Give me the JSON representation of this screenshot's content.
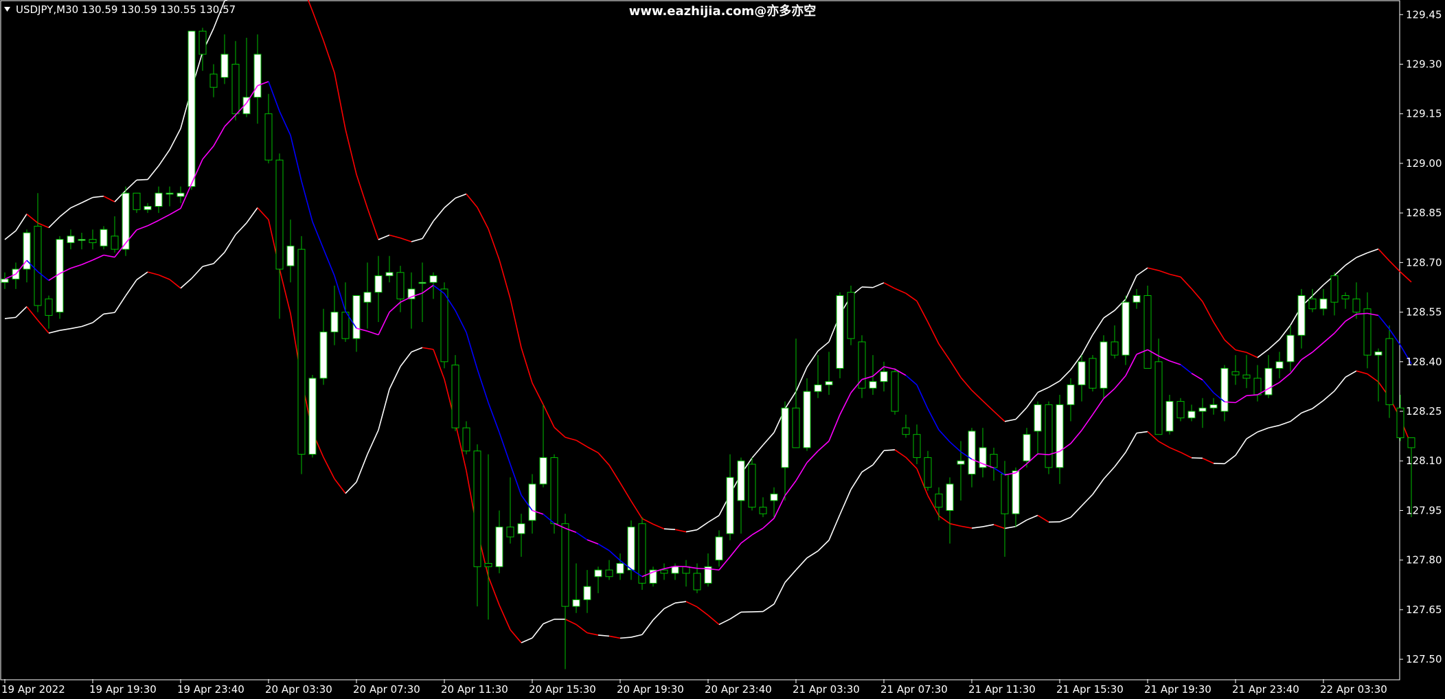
{
  "header": {
    "symbol_info": "USDJPY,M30  130.59 130.59 130.55 130.57",
    "watermark": "www.eazhijia.com@亦多亦空",
    "menu_icon": "triangle-down-icon"
  },
  "colors": {
    "background": "#000000",
    "frame": "#ffffff",
    "bull_candle": "#ffffff",
    "bear_candle": "#000000",
    "candle_outline_and_wick": "#00c000",
    "ma_line": "#ff00ff",
    "ma_down_segment": "#0000ff",
    "envelope_band": "#ffffff",
    "envelope_falling_segment": "#ff0000",
    "text": "#ffffff"
  },
  "chart_data": {
    "type": "candlestick",
    "symbol": "USDJPY",
    "timeframe": "M30",
    "ylim": [
      127.44,
      129.49
    ],
    "y_ticks": [
      129.45,
      129.3,
      129.15,
      129.0,
      128.85,
      128.7,
      128.55,
      128.4,
      128.25,
      128.1,
      127.95,
      127.8,
      127.65,
      127.5
    ],
    "x_ticks": [
      {
        "bar": 0,
        "label": "19 Apr 2022"
      },
      {
        "bar": 8,
        "label": "19 Apr 19:30"
      },
      {
        "bar": 16,
        "label": "19 Apr 23:40"
      },
      {
        "bar": 24,
        "label": "20 Apr 03:30"
      },
      {
        "bar": 32,
        "label": "20 Apr 07:30"
      },
      {
        "bar": 40,
        "label": "20 Apr 11:30"
      },
      {
        "bar": 48,
        "label": "20 Apr 15:30"
      },
      {
        "bar": 56,
        "label": "20 Apr 19:30"
      },
      {
        "bar": 64,
        "label": "20 Apr 23:40"
      },
      {
        "bar": 72,
        "label": "21 Apr 03:30"
      },
      {
        "bar": 80,
        "label": "21 Apr 07:30"
      },
      {
        "bar": 88,
        "label": "21 Apr 11:30"
      },
      {
        "bar": 96,
        "label": "21 Apr 15:30"
      },
      {
        "bar": 104,
        "label": "21 Apr 19:30"
      },
      {
        "bar": 112,
        "label": "21 Apr 23:40"
      },
      {
        "bar": 120,
        "label": "22 Apr 03:30"
      }
    ],
    "candles": [
      [
        128.64,
        128.67,
        128.62,
        128.65
      ],
      [
        128.65,
        128.7,
        128.62,
        128.68
      ],
      [
        128.68,
        128.8,
        128.64,
        128.79
      ],
      [
        128.81,
        128.91,
        128.55,
        128.57
      ],
      [
        128.59,
        128.6,
        128.5,
        128.54
      ],
      [
        128.55,
        128.78,
        128.53,
        128.77
      ],
      [
        128.76,
        128.8,
        128.74,
        128.78
      ],
      [
        128.77,
        128.79,
        128.74,
        128.77
      ],
      [
        128.77,
        128.8,
        128.74,
        128.76
      ],
      [
        128.75,
        128.81,
        128.74,
        128.8
      ],
      [
        128.78,
        128.84,
        128.73,
        128.74
      ],
      [
        128.74,
        128.93,
        128.72,
        128.91
      ],
      [
        128.91,
        128.91,
        128.85,
        128.86
      ],
      [
        128.86,
        128.88,
        128.85,
        128.87
      ],
      [
        128.87,
        128.93,
        128.85,
        128.91
      ],
      [
        128.91,
        128.93,
        128.87,
        128.91
      ],
      [
        128.9,
        128.93,
        128.88,
        128.91
      ],
      [
        128.93,
        129.4,
        128.92,
        129.4
      ],
      [
        129.4,
        129.41,
        129.28,
        129.33
      ],
      [
        129.27,
        129.3,
        129.2,
        129.23
      ],
      [
        129.26,
        129.39,
        129.24,
        129.33
      ],
      [
        129.3,
        129.37,
        129.13,
        129.15
      ],
      [
        129.15,
        129.38,
        129.14,
        129.2
      ],
      [
        129.2,
        129.39,
        129.12,
        129.33
      ],
      [
        129.15,
        129.21,
        129.0,
        129.01
      ],
      [
        129.01,
        129.03,
        128.53,
        128.68
      ],
      [
        128.69,
        128.83,
        128.64,
        128.75
      ],
      [
        128.74,
        128.78,
        128.06,
        128.12
      ],
      [
        128.12,
        128.36,
        128.11,
        128.35
      ],
      [
        128.35,
        128.56,
        128.33,
        128.49
      ],
      [
        128.49,
        128.63,
        128.45,
        128.55
      ],
      [
        128.55,
        128.64,
        128.46,
        128.47
      ],
      [
        128.47,
        128.6,
        128.43,
        128.6
      ],
      [
        128.58,
        128.7,
        128.5,
        128.61
      ],
      [
        128.61,
        128.72,
        128.52,
        128.66
      ],
      [
        128.66,
        128.72,
        128.64,
        128.67
      ],
      [
        128.67,
        128.69,
        128.55,
        128.59
      ],
      [
        128.59,
        128.67,
        128.5,
        128.62
      ],
      [
        128.64,
        128.7,
        128.52,
        128.64
      ],
      [
        128.64,
        128.67,
        128.59,
        128.66
      ],
      [
        128.62,
        128.64,
        128.38,
        128.4
      ],
      [
        128.39,
        128.42,
        128.19,
        128.2
      ],
      [
        128.2,
        128.22,
        128.12,
        128.13
      ],
      [
        128.13,
        128.15,
        127.66,
        127.78
      ],
      [
        127.79,
        128.12,
        127.62,
        127.78
      ],
      [
        127.78,
        127.95,
        127.76,
        127.9
      ],
      [
        127.9,
        128.05,
        127.85,
        127.87
      ],
      [
        127.88,
        127.94,
        127.81,
        127.91
      ],
      [
        127.92,
        128.06,
        127.88,
        128.03
      ],
      [
        128.03,
        128.27,
        128.02,
        128.11
      ],
      [
        128.11,
        128.12,
        127.88,
        127.91
      ],
      [
        127.91,
        127.94,
        127.47,
        127.66
      ],
      [
        127.66,
        127.79,
        127.64,
        127.68
      ],
      [
        127.68,
        127.77,
        127.64,
        127.72
      ],
      [
        127.75,
        127.78,
        127.7,
        127.77
      ],
      [
        127.77,
        127.8,
        127.74,
        127.75
      ],
      [
        127.76,
        127.82,
        127.74,
        127.79
      ],
      [
        127.77,
        127.92,
        127.74,
        127.9
      ],
      [
        127.91,
        127.93,
        127.71,
        127.73
      ],
      [
        127.73,
        127.78,
        127.72,
        127.77
      ],
      [
        127.77,
        127.79,
        127.74,
        127.76
      ],
      [
        127.76,
        127.79,
        127.74,
        127.78
      ],
      [
        127.78,
        127.8,
        127.72,
        127.76
      ],
      [
        127.76,
        127.79,
        127.7,
        127.71
      ],
      [
        127.73,
        127.82,
        127.72,
        127.78
      ],
      [
        127.8,
        127.89,
        127.78,
        127.87
      ],
      [
        127.88,
        128.12,
        127.86,
        128.05
      ],
      [
        127.98,
        128.11,
        127.88,
        128.1
      ],
      [
        128.09,
        128.11,
        127.95,
        127.96
      ],
      [
        127.96,
        127.99,
        127.93,
        127.94
      ],
      [
        127.98,
        128.02,
        127.93,
        128.0
      ],
      [
        128.08,
        128.28,
        127.98,
        128.26
      ],
      [
        128.26,
        128.47,
        128.18,
        128.14
      ],
      [
        128.14,
        128.35,
        128.13,
        128.31
      ],
      [
        128.31,
        128.42,
        128.29,
        128.33
      ],
      [
        128.33,
        128.43,
        128.3,
        128.34
      ],
      [
        128.38,
        128.61,
        128.35,
        128.6
      ],
      [
        128.61,
        128.63,
        128.45,
        128.47
      ],
      [
        128.46,
        128.48,
        128.29,
        128.32
      ],
      [
        128.32,
        128.42,
        128.3,
        128.34
      ],
      [
        128.34,
        128.4,
        128.31,
        128.37
      ],
      [
        128.37,
        128.38,
        128.24,
        128.25
      ],
      [
        128.2,
        128.24,
        128.17,
        128.18
      ],
      [
        128.18,
        128.21,
        128.09,
        128.11
      ],
      [
        128.11,
        128.13,
        128.01,
        128.02
      ],
      [
        128.0,
        128.02,
        127.92,
        127.96
      ],
      [
        127.95,
        128.05,
        127.85,
        128.03
      ],
      [
        128.09,
        128.16,
        127.98,
        128.1
      ],
      [
        128.06,
        128.2,
        128.02,
        128.19
      ],
      [
        128.08,
        128.2,
        128.05,
        128.14
      ],
      [
        128.12,
        128.14,
        128.04,
        128.08
      ],
      [
        128.06,
        128.1,
        127.81,
        127.94
      ],
      [
        127.94,
        128.08,
        127.9,
        128.07
      ],
      [
        128.1,
        128.2,
        128.08,
        128.18
      ],
      [
        128.19,
        128.28,
        128.12,
        128.27
      ],
      [
        128.27,
        128.28,
        128.06,
        128.08
      ],
      [
        128.08,
        128.3,
        128.03,
        128.27
      ],
      [
        128.27,
        128.35,
        128.22,
        128.33
      ],
      [
        128.33,
        128.42,
        128.28,
        128.4
      ],
      [
        128.41,
        128.42,
        128.31,
        128.32
      ],
      [
        128.32,
        128.48,
        128.29,
        128.46
      ],
      [
        128.46,
        128.51,
        128.41,
        128.42
      ],
      [
        128.42,
        128.6,
        128.39,
        128.58
      ],
      [
        128.58,
        128.62,
        128.56,
        128.6
      ],
      [
        128.6,
        128.63,
        128.38,
        128.38
      ],
      [
        128.4,
        128.47,
        128.23,
        128.18
      ],
      [
        128.19,
        128.3,
        128.18,
        128.28
      ],
      [
        128.28,
        128.29,
        128.22,
        128.23
      ],
      [
        128.23,
        128.27,
        128.22,
        128.25
      ],
      [
        128.25,
        128.29,
        128.2,
        128.26
      ],
      [
        128.26,
        128.29,
        128.24,
        128.27
      ],
      [
        128.25,
        128.39,
        128.22,
        128.38
      ],
      [
        128.37,
        128.42,
        128.33,
        128.36
      ],
      [
        128.36,
        128.42,
        128.32,
        128.35
      ],
      [
        128.35,
        128.39,
        128.28,
        128.3
      ],
      [
        128.3,
        128.42,
        128.29,
        128.38
      ],
      [
        128.38,
        128.43,
        128.35,
        128.4
      ],
      [
        128.4,
        128.51,
        128.37,
        128.48
      ],
      [
        128.48,
        128.62,
        128.44,
        128.6
      ],
      [
        128.59,
        128.62,
        128.55,
        128.56
      ],
      [
        128.56,
        128.62,
        128.54,
        128.59
      ],
      [
        128.66,
        128.67,
        128.54,
        128.58
      ],
      [
        128.6,
        128.61,
        128.56,
        128.59
      ],
      [
        128.59,
        128.64,
        128.53,
        128.55
      ],
      [
        128.56,
        128.61,
        128.38,
        128.42
      ],
      [
        128.42,
        128.44,
        128.28,
        128.43
      ],
      [
        128.47,
        128.51,
        128.23,
        128.27
      ],
      [
        128.26,
        128.3,
        128.16,
        128.17
      ],
      [
        128.17,
        128.17,
        127.93,
        128.14
      ]
    ]
  }
}
